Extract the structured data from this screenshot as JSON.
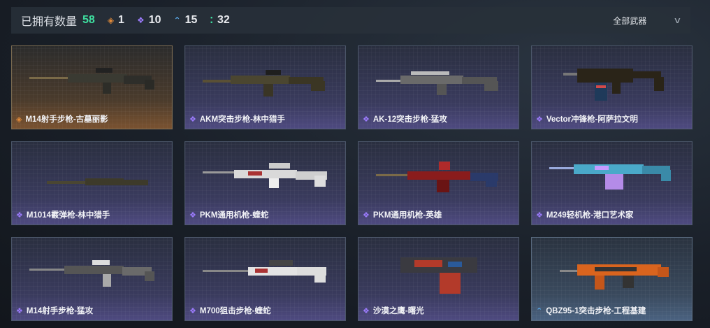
{
  "header": {
    "owned_label": "已拥有数量",
    "owned_count": "58",
    "rarities": [
      {
        "icon": "gold-diamond-icon",
        "count": "1",
        "color": "#e08a3a"
      },
      {
        "icon": "purple-diamond-icon",
        "count": "10",
        "color": "#9d7cff"
      },
      {
        "icon": "blue-chevron-icon",
        "count": "15",
        "color": "#5aa8e8"
      },
      {
        "icon": "green-dots-icon",
        "count": "32",
        "color": "#3ee0a0"
      }
    ],
    "filter_label": "全部武器"
  },
  "weapons": [
    {
      "label": "M14射手步枪-古墓丽影",
      "rarity": "gold"
    },
    {
      "label": "AKM突击步枪-林中猎手",
      "rarity": "purple"
    },
    {
      "label": "AK-12突击步枪-猛攻",
      "rarity": "purple"
    },
    {
      "label": "Vector冲锋枪-阿萨拉文明",
      "rarity": "purple"
    },
    {
      "label": "M1014霰弹枪-林中猎手",
      "rarity": "purple"
    },
    {
      "label": "PKM通用机枪-蝰蛇",
      "rarity": "purple"
    },
    {
      "label": "PKM通用机枪-英雄",
      "rarity": "purple"
    },
    {
      "label": "M249轻机枪-港口艺术家",
      "rarity": "purple"
    },
    {
      "label": "M14射手步枪-猛攻",
      "rarity": "purple"
    },
    {
      "label": "M700狙击步枪-蝰蛇",
      "rarity": "purple"
    },
    {
      "label": "沙漠之鹰-曙光",
      "rarity": "purple"
    },
    {
      "label": "QBZ95-1突击步枪-工程基建",
      "rarity": "blue"
    }
  ]
}
